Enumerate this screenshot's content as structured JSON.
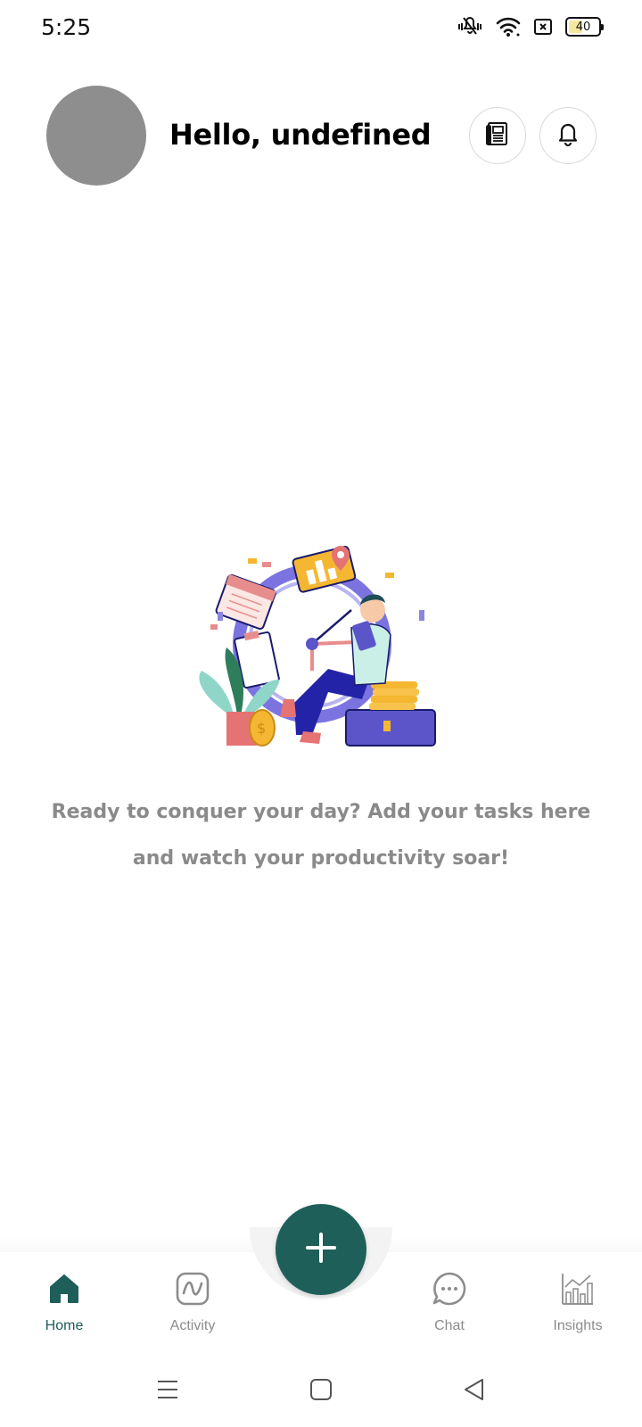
{
  "status_bar": {
    "time": "5:25",
    "battery_level": "40",
    "icons": [
      "vibrate-icon",
      "wifi-icon",
      "sim-off-icon",
      "battery-icon"
    ]
  },
  "header": {
    "greeting": "Hello, undefined",
    "news_icon": "newspaper-icon",
    "bell_icon": "bell-icon"
  },
  "empty_state": {
    "line1": "Ready to conquer your day? Add your tasks here",
    "line2": "and watch your productivity soar!"
  },
  "bottom_nav": {
    "items": [
      {
        "label": "Home",
        "icon": "home-icon",
        "active": true
      },
      {
        "label": "Activity",
        "icon": "activity-icon",
        "active": false
      },
      {
        "label": "Chat",
        "icon": "chat-icon",
        "active": false
      },
      {
        "label": "Insights",
        "icon": "insights-icon",
        "active": false
      }
    ],
    "fab_icon": "plus-icon"
  },
  "colors": {
    "primary": "#1e5f5a",
    "active_label": "#1f5c58",
    "muted_text": "#8a8a8a",
    "avatar": "#8e8e8e"
  }
}
